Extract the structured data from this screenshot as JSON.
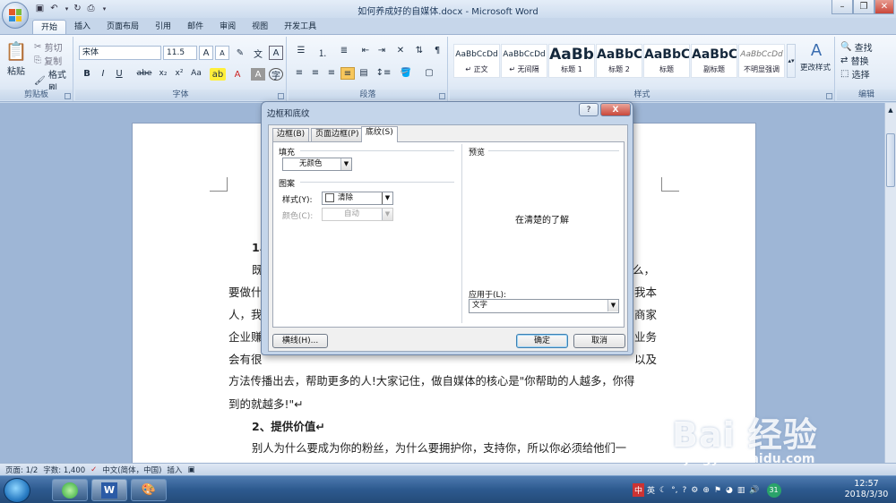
{
  "window": {
    "title": "如何养成好的自媒体.docx - Microsoft Word"
  },
  "ribbon": {
    "tabs": [
      "开始",
      "插入",
      "页面布局",
      "引用",
      "邮件",
      "审阅",
      "视图",
      "开发工具"
    ],
    "clipboard": {
      "paste": "粘贴",
      "cut": "剪切",
      "copy": "复制",
      "format_painter": "格式刷",
      "group": "剪贴板"
    },
    "font": {
      "name": "宋体",
      "size": "11.5",
      "group": "字体",
      "bold": "B",
      "italic": "I",
      "underline": "U",
      "strike": "abe",
      "sub": "x₂",
      "sup": "x²",
      "case": "Aa"
    },
    "paragraph": {
      "group": "段落"
    },
    "styles": {
      "group": "样式",
      "items": [
        {
          "preview": "AaBbCcDd",
          "name": "↵ 正文"
        },
        {
          "preview": "AaBbCcDd",
          "name": "↵ 无间隔"
        },
        {
          "preview": "AaBb",
          "name": "标题 1"
        },
        {
          "preview": "AaBbC",
          "name": "标题 2"
        },
        {
          "preview": "AaBbC",
          "name": "标题"
        },
        {
          "preview": "AaBbC",
          "name": "副标题"
        },
        {
          "preview": "AaBbCcDd",
          "name": "不明显强调"
        }
      ],
      "change": "更改样式"
    },
    "editing": {
      "find": "查找",
      "replace": "替换",
      "select": "选择",
      "group": "编辑"
    }
  },
  "document": {
    "lines": [
      "1、",
      "既",
      "么，",
      "要做什",
      "我本",
      "人，我",
      "商家",
      "企业赚",
      "业务",
      "会有很",
      "以及",
      "方法传播出去，帮助更多的人!大家记住，做自媒体的核心是\"你帮助的人越多，你得",
      "到的就越多!\"↵",
      "2、提供价值↵",
      "别人为什么要成为你的粉丝，为什么要拥护你，支持你，所以你必须给他们一"
    ]
  },
  "status": {
    "page": "页面: 1/2",
    "words": "字数: 1,400",
    "lang": "中文(简体，中国)",
    "mode": "插入"
  },
  "taskbar": {
    "ime": "英",
    "badge": "31",
    "time": "12:57",
    "date": "2018/3/30"
  },
  "dialog": {
    "title": "边框和底纹",
    "tabs": [
      "边框(B)",
      "页面边框(P)",
      "底纹(S)"
    ],
    "active_tab": 2,
    "fill_label": "填充",
    "fill_value": "无颜色",
    "pattern_label": "图案",
    "style_label": "样式(Y):",
    "style_value": "清除",
    "color_label": "颜色(C):",
    "color_value": "自动",
    "preview_label": "预览",
    "preview_text": "在清楚的了解",
    "apply_label": "应用于(L):",
    "apply_value": "文字",
    "hline_button": "横线(H)...",
    "ok_button": "确定",
    "cancel_button": "取消",
    "help": "?",
    "close": "X"
  },
  "watermark": {
    "brand": "Bai 经验",
    "url": "jingyan.baidu.com"
  },
  "colors": {
    "accent": "#9eb6d6",
    "ribbon": "#dce7f5",
    "close_red": "#c9473a"
  }
}
